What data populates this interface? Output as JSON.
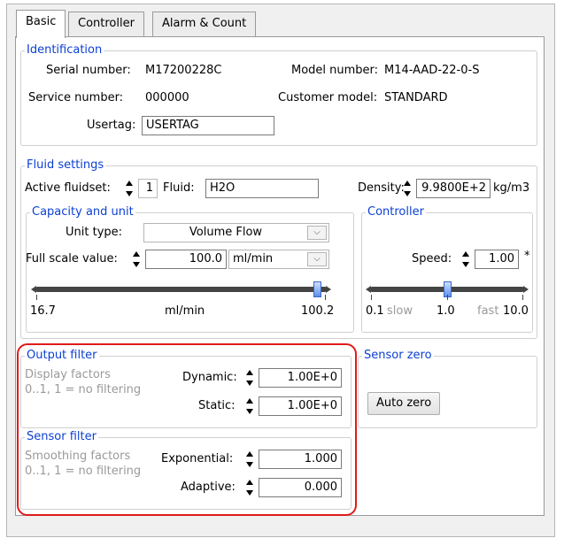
{
  "tabs": [
    {
      "label": "Basic",
      "active": true
    },
    {
      "label": "Controller",
      "active": false
    },
    {
      "label": "Alarm & Count",
      "active": false
    }
  ],
  "identification": {
    "title": "Identification",
    "serial_label": "Serial number:",
    "serial_value": "M17200228C",
    "model_label": "Model number:",
    "model_value": "M14-AAD-22-0-S",
    "service_label": "Service number:",
    "service_value": "000000",
    "customer_label": "Customer model:",
    "customer_value": "STANDARD",
    "usertag_label": "Usertag:",
    "usertag_value": "USERTAG"
  },
  "fluid": {
    "title": "Fluid settings",
    "active_label": "Active fluidset:",
    "active_value": "1",
    "fluid_label": "Fluid:",
    "fluid_value": "H2O",
    "density_label": "Density:",
    "density_value": "9.9800E+2",
    "density_unit": "kg/m3"
  },
  "capacity": {
    "title": "Capacity and unit",
    "unit_type_label": "Unit type:",
    "unit_type_value": "Volume Flow",
    "full_scale_label": "Full scale value:",
    "full_scale_value": "100.0",
    "full_scale_unit": "ml/min",
    "slider_min": "16.7",
    "slider_unit": "ml/min",
    "slider_max": "100.2",
    "slider_level": 0.97
  },
  "controller": {
    "title": "Controller",
    "speed_label": "Speed:",
    "speed_value": "1.00",
    "speed_marker": "*",
    "min_value": "0.1",
    "slow_label": "slow",
    "mid_value": "1.0",
    "fast_label": "fast",
    "max_value": "10.0",
    "slider_level": 0.5
  },
  "output_filter": {
    "title": "Output filter",
    "hint_line1": "Display factors",
    "hint_line2": "0..1, 1 = no filtering",
    "dynamic_label": "Dynamic:",
    "dynamic_value": "1.00E+0",
    "static_label": "Static:",
    "static_value": "1.00E+0"
  },
  "sensor_filter": {
    "title": "Sensor filter",
    "hint_line1": "Smoothing factors",
    "hint_line2": "0..1, 1 = no filtering",
    "exponential_label": "Exponential:",
    "exponential_value": "1.000",
    "adaptive_label": "Adaptive:",
    "adaptive_value": "0.000"
  },
  "sensor_zero": {
    "title": "Sensor zero",
    "button_label": "Auto zero"
  },
  "colors": {
    "group_title": "#0b3fd3",
    "highlight": "#e01b1b",
    "slider_thumb": "#5d8fe8"
  }
}
